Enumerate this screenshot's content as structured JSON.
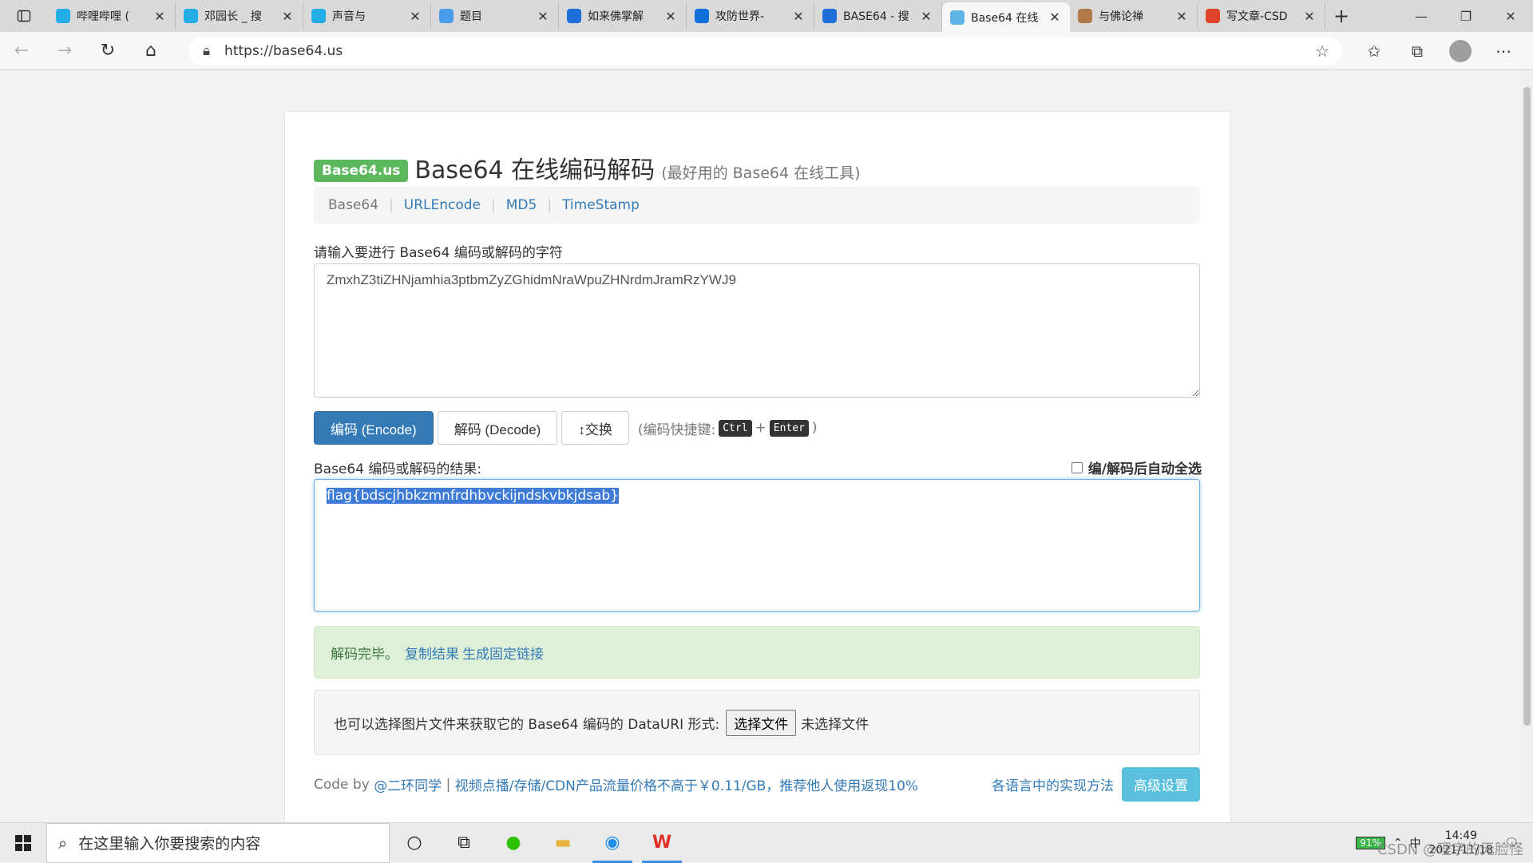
{
  "browser": {
    "tabs": [
      {
        "title": "哔哩哔哩 (",
        "icon": "bilibili-icon",
        "color": "#23ade5"
      },
      {
        "title": "邓园长 _ 搜",
        "icon": "bilibili-icon",
        "color": "#23ade5"
      },
      {
        "title": "声音与",
        "icon": "bilibili-icon",
        "color": "#23ade5"
      },
      {
        "title": "题目",
        "icon": "globe-icon",
        "color": "#4a9be8"
      },
      {
        "title": "如来佛掌解",
        "icon": "bing-icon",
        "color": "#1e6fd9"
      },
      {
        "title": "攻防世界-",
        "icon": "zhihu-icon",
        "color": "#0f6fdb"
      },
      {
        "title": "BASE64 - 搜",
        "icon": "bing-icon",
        "color": "#1e6fd9"
      },
      {
        "title": "Base64 在线",
        "icon": "base64-icon",
        "color": "#5fb3e6",
        "active": true
      },
      {
        "title": "与佛论禅",
        "icon": "avatar-icon",
        "color": "#b07a4a"
      },
      {
        "title": "写文章-CSD",
        "icon": "csdn-icon",
        "color": "#e0432b"
      }
    ],
    "url": "https://base64.us"
  },
  "page": {
    "brand": "Base64.us",
    "title": "Base64 在线编码解码",
    "subtitle": "(最好用的 Base64 在线工具)",
    "nav": {
      "current": "Base64",
      "links": [
        "URLEncode",
        "MD5",
        "TimeStamp"
      ]
    },
    "input_label": "请输入要进行 Base64 编码或解码的字符",
    "input_value": "ZmxhZ3tiZHNjamhia3ptbmZyZGhidmNraWpuZHNrdmJramRzYWJ9",
    "btn_encode": "编码 (Encode)",
    "btn_decode": "解码 (Decode)",
    "btn_swap": "↕交换",
    "shortcut_prefix": "(编码快捷键:",
    "kbd1": "Ctrl",
    "kbd_plus": "+",
    "kbd2": "Enter",
    "shortcut_suffix": ")",
    "output_label": "Base64 编码或解码的结果:",
    "auto_select_label": "编/解码后自动全选",
    "output_value": "flag{bdscjhbkzmnfrdhbvckijndskvbkjdsab}",
    "alert_text": "解码完毕。",
    "alert_copy": "复制结果",
    "alert_link": "生成固定链接",
    "file_text": "也可以选择图片文件来获取它的 Base64 编码的 DataURI 形式:",
    "file_button": "选择文件",
    "file_status": "未选择文件",
    "footer_code_by": "Code by",
    "footer_author": "@二环同学",
    "footer_sep": "|",
    "footer_ad": "视频点播/存储/CDN产品流量价格不高于￥0.11/GB，推荐他人使用返现10%",
    "footer_impl": "各语言中的实现方法",
    "footer_adv": "高级设置"
  },
  "taskbar": {
    "search_placeholder": "在这里输入你要搜索的内容",
    "battery": "91%",
    "ime": "中",
    "time": "14:49",
    "date": "2021/11/18",
    "watermark": "CSDN @理字的无脸怪"
  }
}
